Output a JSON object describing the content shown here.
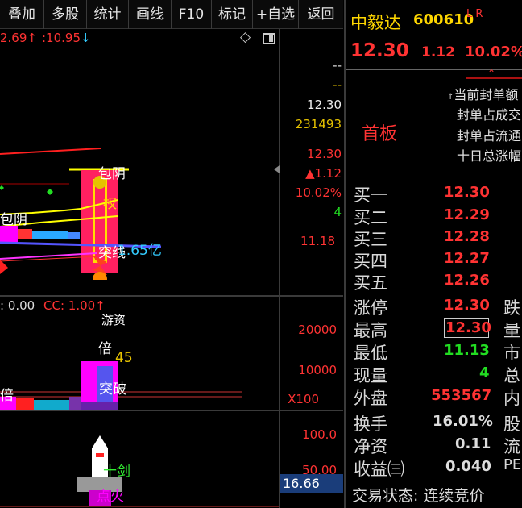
{
  "toolbar": {
    "items": [
      "叠加",
      "多股",
      "统计",
      "画线",
      "F10",
      "标记",
      "+自选",
      "返回"
    ]
  },
  "chart": {
    "top_left_values": [
      "2.69",
      ":10.95"
    ],
    "price_axis": [
      "--",
      "--",
      "12.30",
      "231493",
      "12.30",
      "▲1.12",
      "10.02%",
      "4",
      "11.18"
    ],
    "candle_labels": [
      "包阴",
      "包阴",
      "权",
      "突线",
      "1.65亿"
    ],
    "indicator_header": [
      ": 0.00",
      "CC: 1.00"
    ],
    "vol_labels": [
      "倍",
      "45",
      "倍",
      "突破",
      "游资"
    ],
    "vol_axis": [
      "20000",
      "10000",
      "X100"
    ],
    "lower_axis": [
      "100.0",
      "50.00",
      "16.66"
    ],
    "lower_labels": [
      "十剑",
      "点火"
    ],
    "icons": [
      "diamond-icon",
      "layout-icon"
    ]
  },
  "stock": {
    "name": "中毅达",
    "code": "600610",
    "flags": "L R",
    "price": "12.30",
    "change": "1.12",
    "change_pct": "10.02%",
    "board": "首板",
    "seal_info": [
      "当前封单额",
      "封单占成交",
      "封单占流通",
      "十日总涨幅"
    ]
  },
  "order_book": [
    {
      "label": "买一",
      "price": "12.30"
    },
    {
      "label": "买二",
      "price": "12.29"
    },
    {
      "label": "买三",
      "price": "12.28"
    },
    {
      "label": "买四",
      "price": "12.27"
    },
    {
      "label": "买五",
      "price": "12.26"
    }
  ],
  "quote_stats": [
    {
      "label": "涨停",
      "value": "12.30",
      "color": "#ff3333",
      "right": "跌"
    },
    {
      "label": "最高",
      "value": "12.30",
      "color": "#ff3333",
      "right": "量"
    },
    {
      "label": "最低",
      "value": "11.13",
      "color": "#22dd22",
      "right": "市"
    },
    {
      "label": "现量",
      "value": "4",
      "color": "#22dd22",
      "right": "总"
    },
    {
      "label": "外盘",
      "value": "553567",
      "color": "#ff3333",
      "right": "内"
    }
  ],
  "fundamentals": [
    {
      "label": "换手",
      "value": "16.01%",
      "right": "股"
    },
    {
      "label": "净资",
      "value": "0.11",
      "right": "流"
    },
    {
      "label": "收益㈢",
      "value": "0.040",
      "right": "PE"
    }
  ],
  "trade_status": "交易状态: 连续竞价"
}
